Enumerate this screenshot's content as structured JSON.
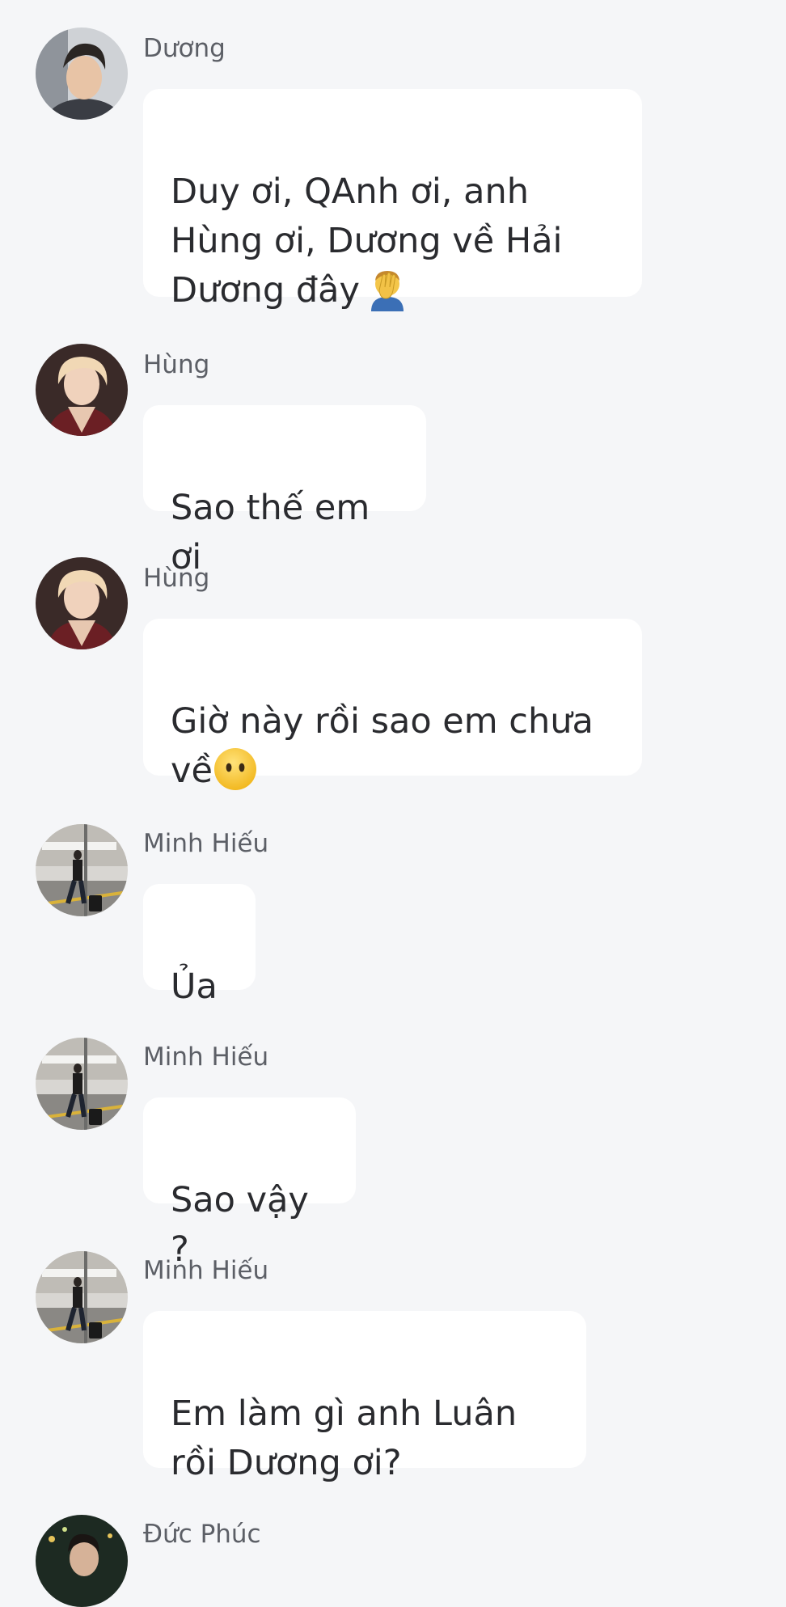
{
  "messages": [
    {
      "sender": "Dương",
      "text": "Duy ơi, QAnh ơi, anh Hùng ơi, Dương về Hải Dương đây",
      "emoji": "facepalm-emoji"
    },
    {
      "sender": "Hùng",
      "text": "Sao thế em ơi",
      "emoji": ""
    },
    {
      "sender": "Hùng",
      "text": "Giờ này rồi sao em chưa về",
      "emoji": "face-without-mouth-emoji"
    },
    {
      "sender": "Minh Hiếu",
      "text": "Ủa",
      "emoji": ""
    },
    {
      "sender": "Minh Hiếu",
      "text": "Sao vậy ?",
      "emoji": ""
    },
    {
      "sender": "Minh Hiếu",
      "text": "Em làm gì anh Luân rồi Dương ơi?",
      "emoji": ""
    },
    {
      "sender": "Đức Phúc",
      "text": "",
      "emoji": ""
    }
  ],
  "colors": {
    "background": "#f5f6f8",
    "bubble": "#ffffff",
    "text": "#2a2b2f",
    "sender": "#5c5f66"
  }
}
